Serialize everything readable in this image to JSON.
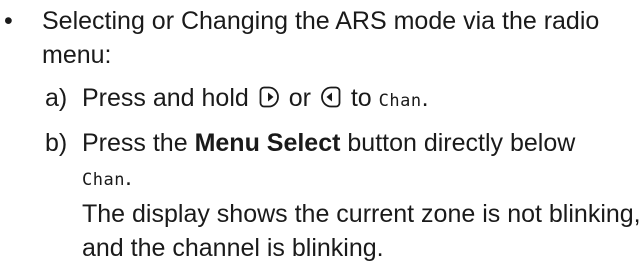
{
  "bullet": {
    "symbol": "•",
    "text": "Selecting or Changing the ARS mode via the radio menu:"
  },
  "steps": [
    {
      "marker": "a)",
      "prefix": "Press and hold",
      "icon_right": "right-navigation-key-icon",
      "conj": "or",
      "icon_left": "left-navigation-key-icon",
      "to": "to",
      "lcd": "Chan",
      "suffix": "."
    },
    {
      "marker": "b)",
      "prefix": "Press the",
      "bold": "Menu Select",
      "middle": "button directly below",
      "lcd": "Chan",
      "suffix": ".",
      "result": "The display shows the current zone is not blinking, and the channel is blinking."
    }
  ]
}
